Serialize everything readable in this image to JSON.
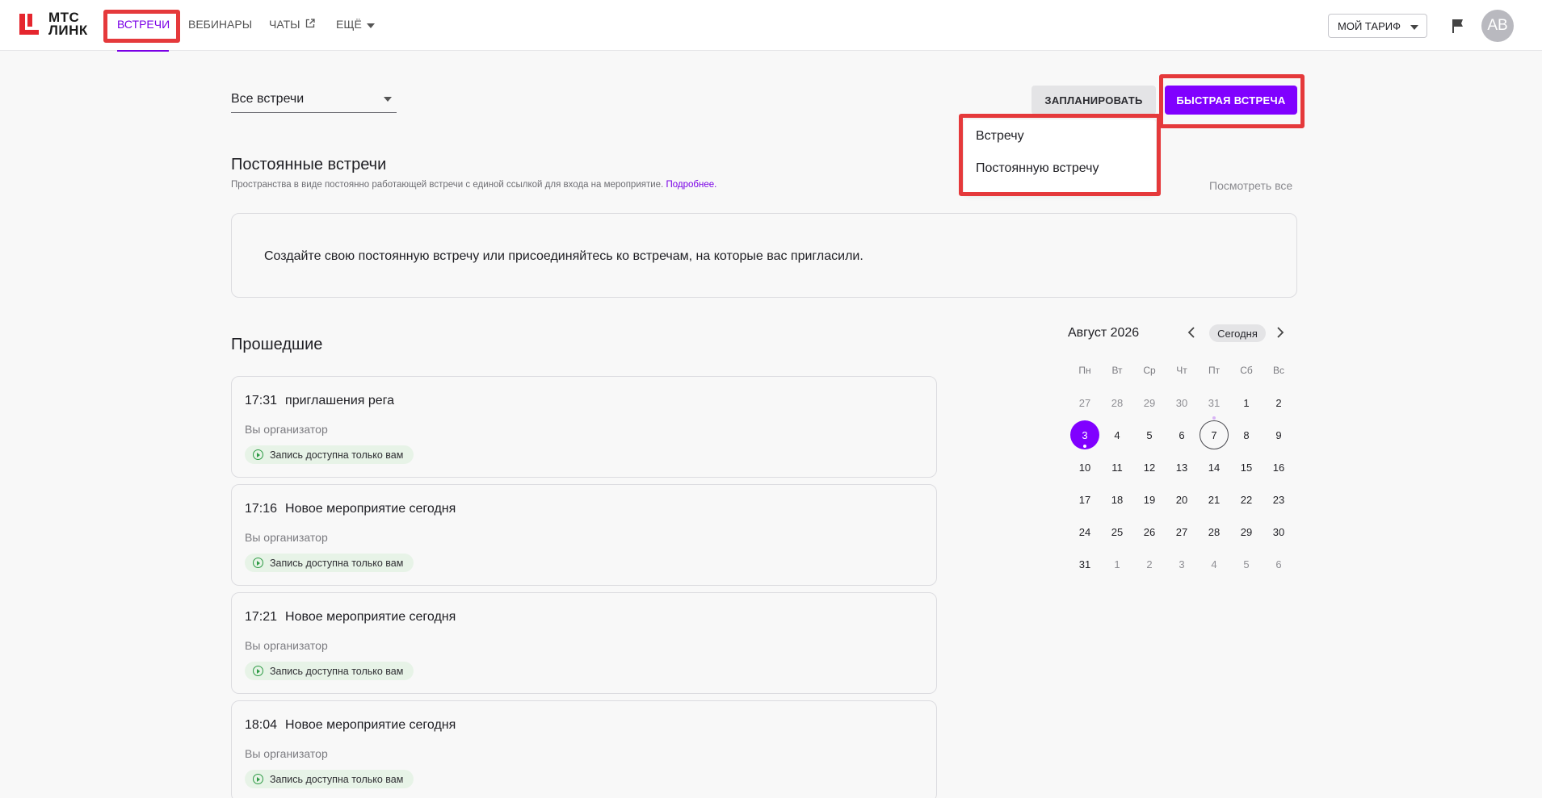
{
  "header": {
    "logo_text_line1": "МТС",
    "logo_text_line2": "ЛИНК",
    "nav": [
      {
        "label": "ВСТРЕЧИ",
        "active": true
      },
      {
        "label": "ВЕБИНАРЫ"
      },
      {
        "label": "ЧАТЫ"
      },
      {
        "label": "ЕЩЁ"
      }
    ],
    "tariff_label": "МОЙ ТАРИФ",
    "avatar_initials": "АВ"
  },
  "toolbar": {
    "filter_value": "Все встречи",
    "plan_button": "ЗАПЛАНИРОВАТЬ",
    "quick_button": "БЫСТРАЯ ВСТРЕЧА"
  },
  "plan_menu": {
    "items": [
      "Встречу",
      "Постоянную встречу"
    ]
  },
  "permanent": {
    "title": "Постоянные встречи",
    "subtitle": "Пространства в виде постоянно работающей встречи с единой ссылкой для входа на мероприятие.",
    "more_link": "Подробнее.",
    "view_all": "Посмотреть все",
    "empty_message": "Создайте свою постоянную встречу или присоединяйтесь ко встречам, на которые вас пригласили."
  },
  "past": {
    "title": "Прошедшие",
    "meetings": [
      {
        "time": "17:31",
        "name": "приглашения рега",
        "role": "Вы организатор",
        "badge": "Запись доступна только вам"
      },
      {
        "time": "17:16",
        "name": "Новое мероприятие сегодня",
        "role": "Вы организатор",
        "badge": "Запись доступна только вам"
      },
      {
        "time": "17:21",
        "name": "Новое мероприятие сегодня",
        "role": "Вы организатор",
        "badge": "Запись доступна только вам"
      },
      {
        "time": "18:04",
        "name": "Новое мероприятие сегодня",
        "role": "Вы организатор",
        "badge": "Запись доступна только вам"
      }
    ]
  },
  "calendar": {
    "month_label": "Август 2026",
    "today_button": "Сегодня",
    "weekdays": [
      "Пн",
      "Вт",
      "Ср",
      "Чт",
      "Пт",
      "Сб",
      "Вс"
    ],
    "weeks": [
      [
        "27",
        "28",
        "29",
        "30",
        "31",
        "1",
        "2"
      ],
      [
        "3",
        "4",
        "5",
        "6",
        "7",
        "8",
        "9"
      ],
      [
        "10",
        "11",
        "12",
        "13",
        "14",
        "15",
        "16"
      ],
      [
        "17",
        "18",
        "19",
        "20",
        "21",
        "22",
        "23"
      ],
      [
        "24",
        "25",
        "26",
        "27",
        "28",
        "29",
        "30"
      ],
      [
        "31",
        "1",
        "2",
        "3",
        "4",
        "5",
        "6"
      ]
    ],
    "selected_day": "3",
    "current_day": "7"
  },
  "colors": {
    "accent": "#8000ff",
    "highlight": "#e5393b",
    "badge_bg": "#e7f3e7",
    "badge_icon": "#2e9b45"
  }
}
